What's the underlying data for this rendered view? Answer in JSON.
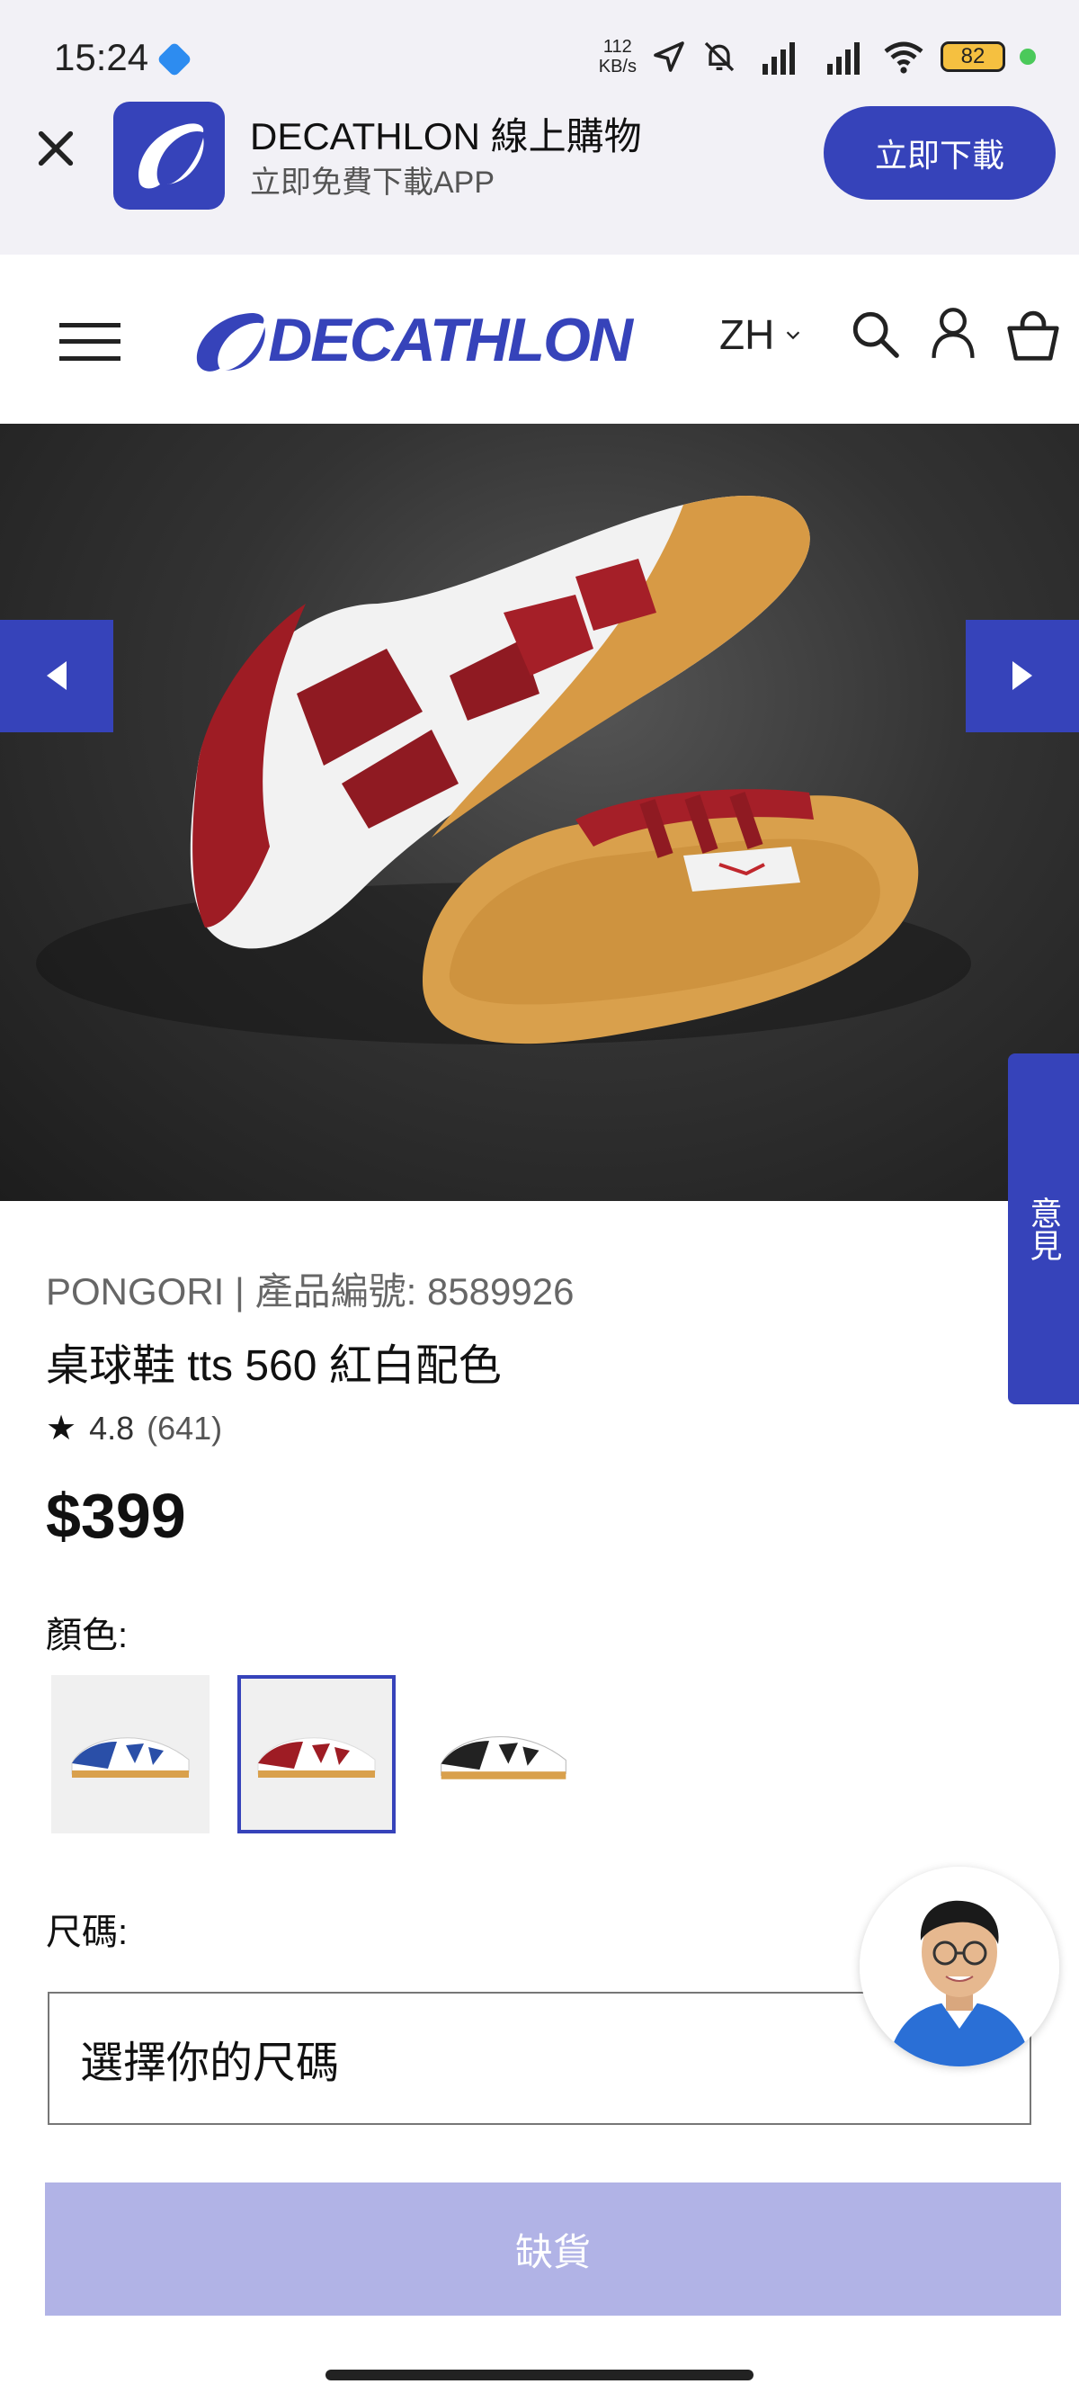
{
  "status_bar": {
    "time": "15:24",
    "network_speed_top": "112",
    "network_speed_bottom": "KB/s",
    "battery": "82"
  },
  "app_banner": {
    "title": "DECATHLON 線上購物",
    "subtitle": "立即免費下載APP",
    "download_label": "立即下載"
  },
  "header": {
    "brand": "DECATHLON",
    "language": "ZH"
  },
  "feedback_label": "意見",
  "product": {
    "meta": "PONGORI | 產品編號: 8589926",
    "title": "桌球鞋 tts 560 紅白配色",
    "rating": "4.8",
    "review_count": "(641)",
    "price": "$399",
    "color_label": "顏色:",
    "size_label": "尺碼:",
    "size_placeholder": "選擇你的尺碼",
    "cta_label": "缺貨"
  },
  "colors": {
    "brand_blue": "#3643ba",
    "disabled_button": "#b1b3e6"
  }
}
